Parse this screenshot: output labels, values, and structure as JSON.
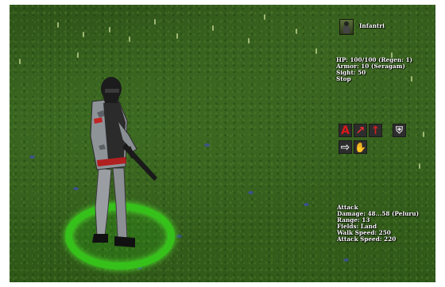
{
  "unit": {
    "name": "Infantri",
    "portrait_icon": "soldier-portrait-icon"
  },
  "stats": {
    "hp": "HP: 100/100 (Regen: 1)",
    "armor": "Armor: 10 (Seragam)",
    "sight": "Sight: 50",
    "status": "Stop"
  },
  "commands": [
    {
      "name": "attack-command",
      "icon": "attack-A-icon",
      "glyph": "A",
      "color": "#e01818"
    },
    {
      "name": "move-command",
      "icon": "move-arrow-icon",
      "glyph": "↗",
      "color": "#e03030"
    },
    {
      "name": "stop-command",
      "icon": "stop-icon",
      "glyph": "↑",
      "color": "#d02020"
    },
    {
      "name": "defend-command",
      "icon": "shield-icon",
      "glyph": "⛨",
      "color": "#dddddd"
    },
    {
      "name": "patrol-command",
      "icon": "patrol-arrow-icon",
      "glyph": "⇨",
      "color": "#e8e8e8"
    },
    {
      "name": "hold-command",
      "icon": "hand-icon",
      "glyph": "✋",
      "color": "#e8e8e8"
    }
  ],
  "attack": {
    "title": "Attack",
    "damage": "Damage: 48...58 (Peluru)",
    "range": "Range: 13",
    "fields": "Fields: Land",
    "walk_speed": "Walk Speed: 250",
    "attack_speed": "Attack Speed: 220"
  },
  "colors": {
    "selection_ring": "#35c11a",
    "grass": "#36621f",
    "hud_text": "#ffffff"
  }
}
